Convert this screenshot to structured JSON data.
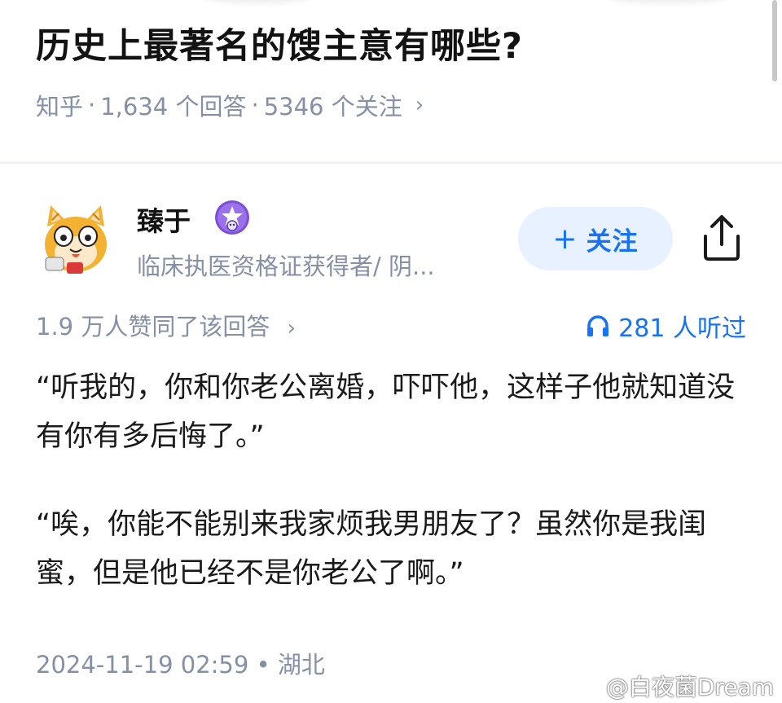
{
  "question": {
    "title": "历史上最著名的馊主意有哪些?",
    "source": "知乎",
    "answers_count": "1,634 个回答",
    "followers_count": "5346 个关注",
    "separator": "·",
    "chevron": "›"
  },
  "author": {
    "name": "臻于",
    "description": "临床执医资格证获得者/ 阴...",
    "avatar_icon": "cartoon-cat-avatar",
    "badge_icon": "star-badge-icon"
  },
  "actions": {
    "follow_plus": "+",
    "follow_label": "关注",
    "share_icon": "share-icon"
  },
  "stats": {
    "upvotes": "1.9 万人赞同了该回答",
    "chevron": "›",
    "listens": "281 人听过",
    "listen_icon": "headphones-icon"
  },
  "answer": {
    "paragraph1": "“听我的，你和你老公离婚，吓吓他，这样子他就知道没有你有多后悔了。”",
    "paragraph2": "“唉，你能不能别来我家烦我男朋友了？虽然你是我闺蜜，但是他已经不是你老公了啊。”"
  },
  "footer": {
    "timestamp": "2024-11-19 02:59",
    "separator": "•",
    "location": "湖北"
  },
  "watermark": "@白夜菌Dream",
  "colors": {
    "accent": "#1772f6",
    "follow_bg": "#e8f1ff",
    "meta_text": "#8590a6",
    "title_text": "#121212"
  }
}
